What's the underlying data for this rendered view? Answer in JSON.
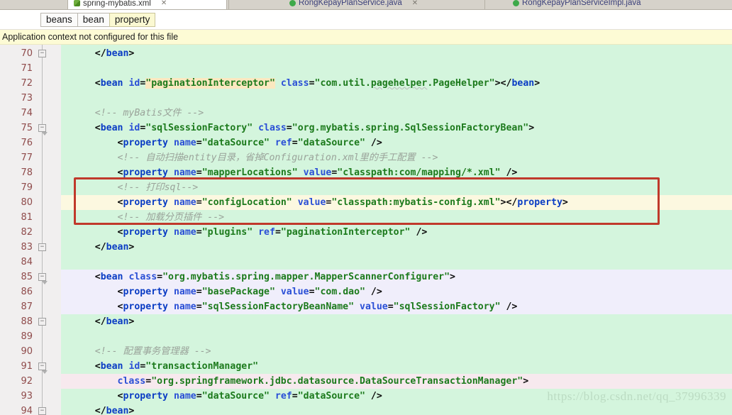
{
  "window": {
    "tabs": [
      {
        "label": "spring-mybatis.xml",
        "icon": "xml-file-icon",
        "active": true,
        "closable": true
      },
      {
        "label": "RongKepayPlanService.java",
        "icon": "java-class-icon",
        "active": false,
        "closable": true
      },
      {
        "label": "RongKepayPlanServiceImpl.java",
        "icon": "java-class-icon",
        "active": false,
        "closable": false
      }
    ]
  },
  "breadcrumb": {
    "items": [
      {
        "label": "beans",
        "selected": false
      },
      {
        "label": "bean",
        "selected": false
      },
      {
        "label": "property",
        "selected": true
      }
    ]
  },
  "notification": {
    "text": "Application context not configured for this file",
    "background": "#fdfbd5"
  },
  "annotation": {
    "type": "rectangle-highlight",
    "color": "#c0392b",
    "covers_lines": [
      79,
      80,
      81
    ]
  },
  "watermark": {
    "text": "https://blog.csdn.net/qq_37996339"
  },
  "editor": {
    "language": "xml",
    "background": "#d4f5dd",
    "gutter_background": "#f1efef",
    "caret_line": 80,
    "lines": [
      {
        "n": 70,
        "fold": "collapse",
        "bg": "none",
        "tokens": [
          {
            "t": "    ",
            "c": "t-punct"
          },
          {
            "t": "</",
            "c": "t-punct"
          },
          {
            "t": "bean",
            "c": "t-tag"
          },
          {
            "t": ">",
            "c": "t-punct"
          }
        ]
      },
      {
        "n": 71,
        "fold": "none",
        "bg": "none",
        "tokens": []
      },
      {
        "n": 72,
        "fold": "none",
        "bg": "none",
        "tokens": [
          {
            "t": "    ",
            "c": "t-punct"
          },
          {
            "t": "<",
            "c": "t-punct"
          },
          {
            "t": "bean",
            "c": "t-tag"
          },
          {
            "t": " ",
            "c": "t-punct"
          },
          {
            "t": "id",
            "c": "t-attr"
          },
          {
            "t": "=",
            "c": "t-eq"
          },
          {
            "t": "\"paginationInterceptor\"",
            "c": "t-str hl-ident"
          },
          {
            "t": " ",
            "c": "t-punct"
          },
          {
            "t": "class",
            "c": "t-attr"
          },
          {
            "t": "=",
            "c": "t-eq"
          },
          {
            "t": "\"com.util.",
            "c": "t-str"
          },
          {
            "t": "pagehelper",
            "c": "t-str squiggly"
          },
          {
            "t": ".PageHelper\"",
            "c": "t-str"
          },
          {
            "t": ">",
            "c": "t-punct"
          },
          {
            "t": "</",
            "c": "t-punct"
          },
          {
            "t": "bean",
            "c": "t-tag"
          },
          {
            "t": ">",
            "c": "t-punct"
          }
        ]
      },
      {
        "n": 73,
        "fold": "none",
        "bg": "none",
        "tokens": []
      },
      {
        "n": 74,
        "fold": "none",
        "bg": "none",
        "tokens": [
          {
            "t": "    <!-- myBatis文件 -->",
            "c": "t-cmt"
          }
        ]
      },
      {
        "n": 75,
        "fold": "collapse-tail",
        "bg": "none",
        "tokens": [
          {
            "t": "    ",
            "c": "t-punct"
          },
          {
            "t": "<",
            "c": "t-punct"
          },
          {
            "t": "bean",
            "c": "t-tag"
          },
          {
            "t": " ",
            "c": "t-punct"
          },
          {
            "t": "id",
            "c": "t-attr"
          },
          {
            "t": "=",
            "c": "t-eq"
          },
          {
            "t": "\"sqlSessionFactory\"",
            "c": "t-str"
          },
          {
            "t": " ",
            "c": "t-punct"
          },
          {
            "t": "class",
            "c": "t-attr"
          },
          {
            "t": "=",
            "c": "t-eq"
          },
          {
            "t": "\"org.mybatis.spring.SqlSessionFactoryBean\"",
            "c": "t-str"
          },
          {
            "t": ">",
            "c": "t-punct"
          }
        ]
      },
      {
        "n": 76,
        "fold": "none",
        "bg": "none",
        "tokens": [
          {
            "t": "        ",
            "c": "t-punct"
          },
          {
            "t": "<",
            "c": "t-punct"
          },
          {
            "t": "property",
            "c": "t-tag"
          },
          {
            "t": " ",
            "c": "t-punct"
          },
          {
            "t": "name",
            "c": "t-attr"
          },
          {
            "t": "=",
            "c": "t-eq"
          },
          {
            "t": "\"dataSource\"",
            "c": "t-str"
          },
          {
            "t": " ",
            "c": "t-punct"
          },
          {
            "t": "ref",
            "c": "t-attr"
          },
          {
            "t": "=",
            "c": "t-eq"
          },
          {
            "t": "\"dataSource\"",
            "c": "t-str"
          },
          {
            "t": " />",
            "c": "t-punct"
          }
        ]
      },
      {
        "n": 77,
        "fold": "none",
        "bg": "none",
        "tokens": [
          {
            "t": "        <!-- 自动扫描entity目录，省掉Configuration.xml里的手工配置 -->",
            "c": "t-cmt"
          }
        ]
      },
      {
        "n": 78,
        "fold": "none",
        "bg": "none",
        "tokens": [
          {
            "t": "        ",
            "c": "t-punct"
          },
          {
            "t": "<",
            "c": "t-punct"
          },
          {
            "t": "property",
            "c": "t-tag"
          },
          {
            "t": " ",
            "c": "t-punct"
          },
          {
            "t": "name",
            "c": "t-attr"
          },
          {
            "t": "=",
            "c": "t-eq"
          },
          {
            "t": "\"mapperLocations\"",
            "c": "t-str"
          },
          {
            "t": " ",
            "c": "t-punct"
          },
          {
            "t": "value",
            "c": "t-attr"
          },
          {
            "t": "=",
            "c": "t-eq"
          },
          {
            "t": "\"classpath:com/mapping/*.xml\"",
            "c": "t-str"
          },
          {
            "t": " />",
            "c": "t-punct"
          }
        ]
      },
      {
        "n": 79,
        "fold": "none",
        "bg": "none",
        "tokens": [
          {
            "t": "        <!-- 打印sql-->",
            "c": "t-cmt"
          }
        ]
      },
      {
        "n": 80,
        "fold": "none",
        "bg": "caret",
        "tokens": [
          {
            "t": "        ",
            "c": "t-punct"
          },
          {
            "t": "<",
            "c": "t-punct"
          },
          {
            "t": "property",
            "c": "t-tag"
          },
          {
            "t": " ",
            "c": "t-punct"
          },
          {
            "t": "name",
            "c": "t-attr"
          },
          {
            "t": "=",
            "c": "t-eq"
          },
          {
            "t": "\"configLocation\"",
            "c": "t-str"
          },
          {
            "t": " ",
            "c": "t-punct"
          },
          {
            "t": "value",
            "c": "t-attr"
          },
          {
            "t": "=",
            "c": "t-eq"
          },
          {
            "t": "\"classpath:mybatis-config.xml\"",
            "c": "t-str"
          },
          {
            "t": ">",
            "c": "t-punct"
          },
          {
            "t": "</",
            "c": "t-punct"
          },
          {
            "t": "property",
            "c": "t-tag"
          },
          {
            "t": ">",
            "c": "t-punct"
          }
        ]
      },
      {
        "n": 81,
        "fold": "none",
        "bg": "none",
        "tokens": [
          {
            "t": "        <!-- 加载分页插件 -->",
            "c": "t-cmt"
          }
        ]
      },
      {
        "n": 82,
        "fold": "none",
        "bg": "none",
        "tokens": [
          {
            "t": "        ",
            "c": "t-punct"
          },
          {
            "t": "<",
            "c": "t-punct"
          },
          {
            "t": "property",
            "c": "t-tag"
          },
          {
            "t": " ",
            "c": "t-punct"
          },
          {
            "t": "name",
            "c": "t-attr"
          },
          {
            "t": "=",
            "c": "t-eq"
          },
          {
            "t": "\"plugins\"",
            "c": "t-str"
          },
          {
            "t": " ",
            "c": "t-punct"
          },
          {
            "t": "ref",
            "c": "t-attr"
          },
          {
            "t": "=",
            "c": "t-eq"
          },
          {
            "t": "\"paginationInterceptor\"",
            "c": "t-str"
          },
          {
            "t": " />",
            "c": "t-punct"
          }
        ]
      },
      {
        "n": 83,
        "fold": "collapse",
        "bg": "none",
        "tokens": [
          {
            "t": "    ",
            "c": "t-punct"
          },
          {
            "t": "</",
            "c": "t-punct"
          },
          {
            "t": "bean",
            "c": "t-tag"
          },
          {
            "t": ">",
            "c": "t-punct"
          }
        ]
      },
      {
        "n": 84,
        "fold": "none",
        "bg": "none",
        "tokens": []
      },
      {
        "n": 85,
        "fold": "collapse-tail",
        "bg": "lavender",
        "tokens": [
          {
            "t": "    ",
            "c": "t-punct"
          },
          {
            "t": "<",
            "c": "t-punct"
          },
          {
            "t": "bean",
            "c": "t-tag"
          },
          {
            "t": " ",
            "c": "t-punct"
          },
          {
            "t": "class",
            "c": "t-attr"
          },
          {
            "t": "=",
            "c": "t-eq"
          },
          {
            "t": "\"org.mybatis.spring.mapper.MapperScannerConfigurer\"",
            "c": "t-str"
          },
          {
            "t": ">",
            "c": "t-punct"
          }
        ]
      },
      {
        "n": 86,
        "fold": "none",
        "bg": "lavender",
        "tokens": [
          {
            "t": "        ",
            "c": "t-punct"
          },
          {
            "t": "<",
            "c": "t-punct"
          },
          {
            "t": "property",
            "c": "t-tag"
          },
          {
            "t": " ",
            "c": "t-punct"
          },
          {
            "t": "name",
            "c": "t-attr"
          },
          {
            "t": "=",
            "c": "t-eq"
          },
          {
            "t": "\"basePackage\"",
            "c": "t-str"
          },
          {
            "t": " ",
            "c": "t-punct"
          },
          {
            "t": "value",
            "c": "t-attr"
          },
          {
            "t": "=",
            "c": "t-eq"
          },
          {
            "t": "\"com.dao\"",
            "c": "t-str"
          },
          {
            "t": " />",
            "c": "t-punct"
          }
        ]
      },
      {
        "n": 87,
        "fold": "none",
        "bg": "lavender",
        "tokens": [
          {
            "t": "        ",
            "c": "t-punct"
          },
          {
            "t": "<",
            "c": "t-punct"
          },
          {
            "t": "property",
            "c": "t-tag"
          },
          {
            "t": " ",
            "c": "t-punct"
          },
          {
            "t": "name",
            "c": "t-attr"
          },
          {
            "t": "=",
            "c": "t-eq"
          },
          {
            "t": "\"sqlSessionFactoryBeanName\"",
            "c": "t-str"
          },
          {
            "t": " ",
            "c": "t-punct"
          },
          {
            "t": "value",
            "c": "t-attr"
          },
          {
            "t": "=",
            "c": "t-eq"
          },
          {
            "t": "\"sqlSessionFactory\"",
            "c": "t-str"
          },
          {
            "t": " />",
            "c": "t-punct"
          }
        ]
      },
      {
        "n": 88,
        "fold": "collapse",
        "bg": "none",
        "tokens": [
          {
            "t": "    ",
            "c": "t-punct"
          },
          {
            "t": "</",
            "c": "t-punct"
          },
          {
            "t": "bean",
            "c": "t-tag"
          },
          {
            "t": ">",
            "c": "t-punct"
          }
        ]
      },
      {
        "n": 89,
        "fold": "none",
        "bg": "none",
        "tokens": []
      },
      {
        "n": 90,
        "fold": "none",
        "bg": "none",
        "tokens": [
          {
            "t": "    <!-- 配置事务管理器 -->",
            "c": "t-cmt"
          }
        ]
      },
      {
        "n": 91,
        "fold": "collapse-tail",
        "bg": "none",
        "tokens": [
          {
            "t": "    ",
            "c": "t-punct"
          },
          {
            "t": "<",
            "c": "t-punct"
          },
          {
            "t": "bean",
            "c": "t-tag"
          },
          {
            "t": " ",
            "c": "t-punct"
          },
          {
            "t": "id",
            "c": "t-attr"
          },
          {
            "t": "=",
            "c": "t-eq"
          },
          {
            "t": "\"transactionManager\"",
            "c": "t-str"
          }
        ]
      },
      {
        "n": 92,
        "fold": "none",
        "bg": "pinkish",
        "tokens": [
          {
            "t": "        ",
            "c": "t-punct"
          },
          {
            "t": "class",
            "c": "t-attr"
          },
          {
            "t": "=",
            "c": "t-eq"
          },
          {
            "t": "\"org.springframework.jdbc.datasource.DataSourceTransactionManager\"",
            "c": "t-str"
          },
          {
            "t": ">",
            "c": "t-punct"
          }
        ]
      },
      {
        "n": 93,
        "fold": "none",
        "bg": "none",
        "tokens": [
          {
            "t": "        ",
            "c": "t-punct"
          },
          {
            "t": "<",
            "c": "t-punct"
          },
          {
            "t": "property",
            "c": "t-tag"
          },
          {
            "t": " ",
            "c": "t-punct"
          },
          {
            "t": "name",
            "c": "t-attr"
          },
          {
            "t": "=",
            "c": "t-eq"
          },
          {
            "t": "\"dataSource\"",
            "c": "t-str"
          },
          {
            "t": " ",
            "c": "t-punct"
          },
          {
            "t": "ref",
            "c": "t-attr"
          },
          {
            "t": "=",
            "c": "t-eq"
          },
          {
            "t": "\"dataSource\"",
            "c": "t-str"
          },
          {
            "t": " />",
            "c": "t-punct"
          }
        ]
      },
      {
        "n": 94,
        "fold": "collapse",
        "bg": "none",
        "tokens": [
          {
            "t": "    ",
            "c": "t-punct"
          },
          {
            "t": "</",
            "c": "t-punct"
          },
          {
            "t": "bean",
            "c": "t-tag"
          },
          {
            "t": ">",
            "c": "t-punct"
          }
        ]
      }
    ]
  }
}
